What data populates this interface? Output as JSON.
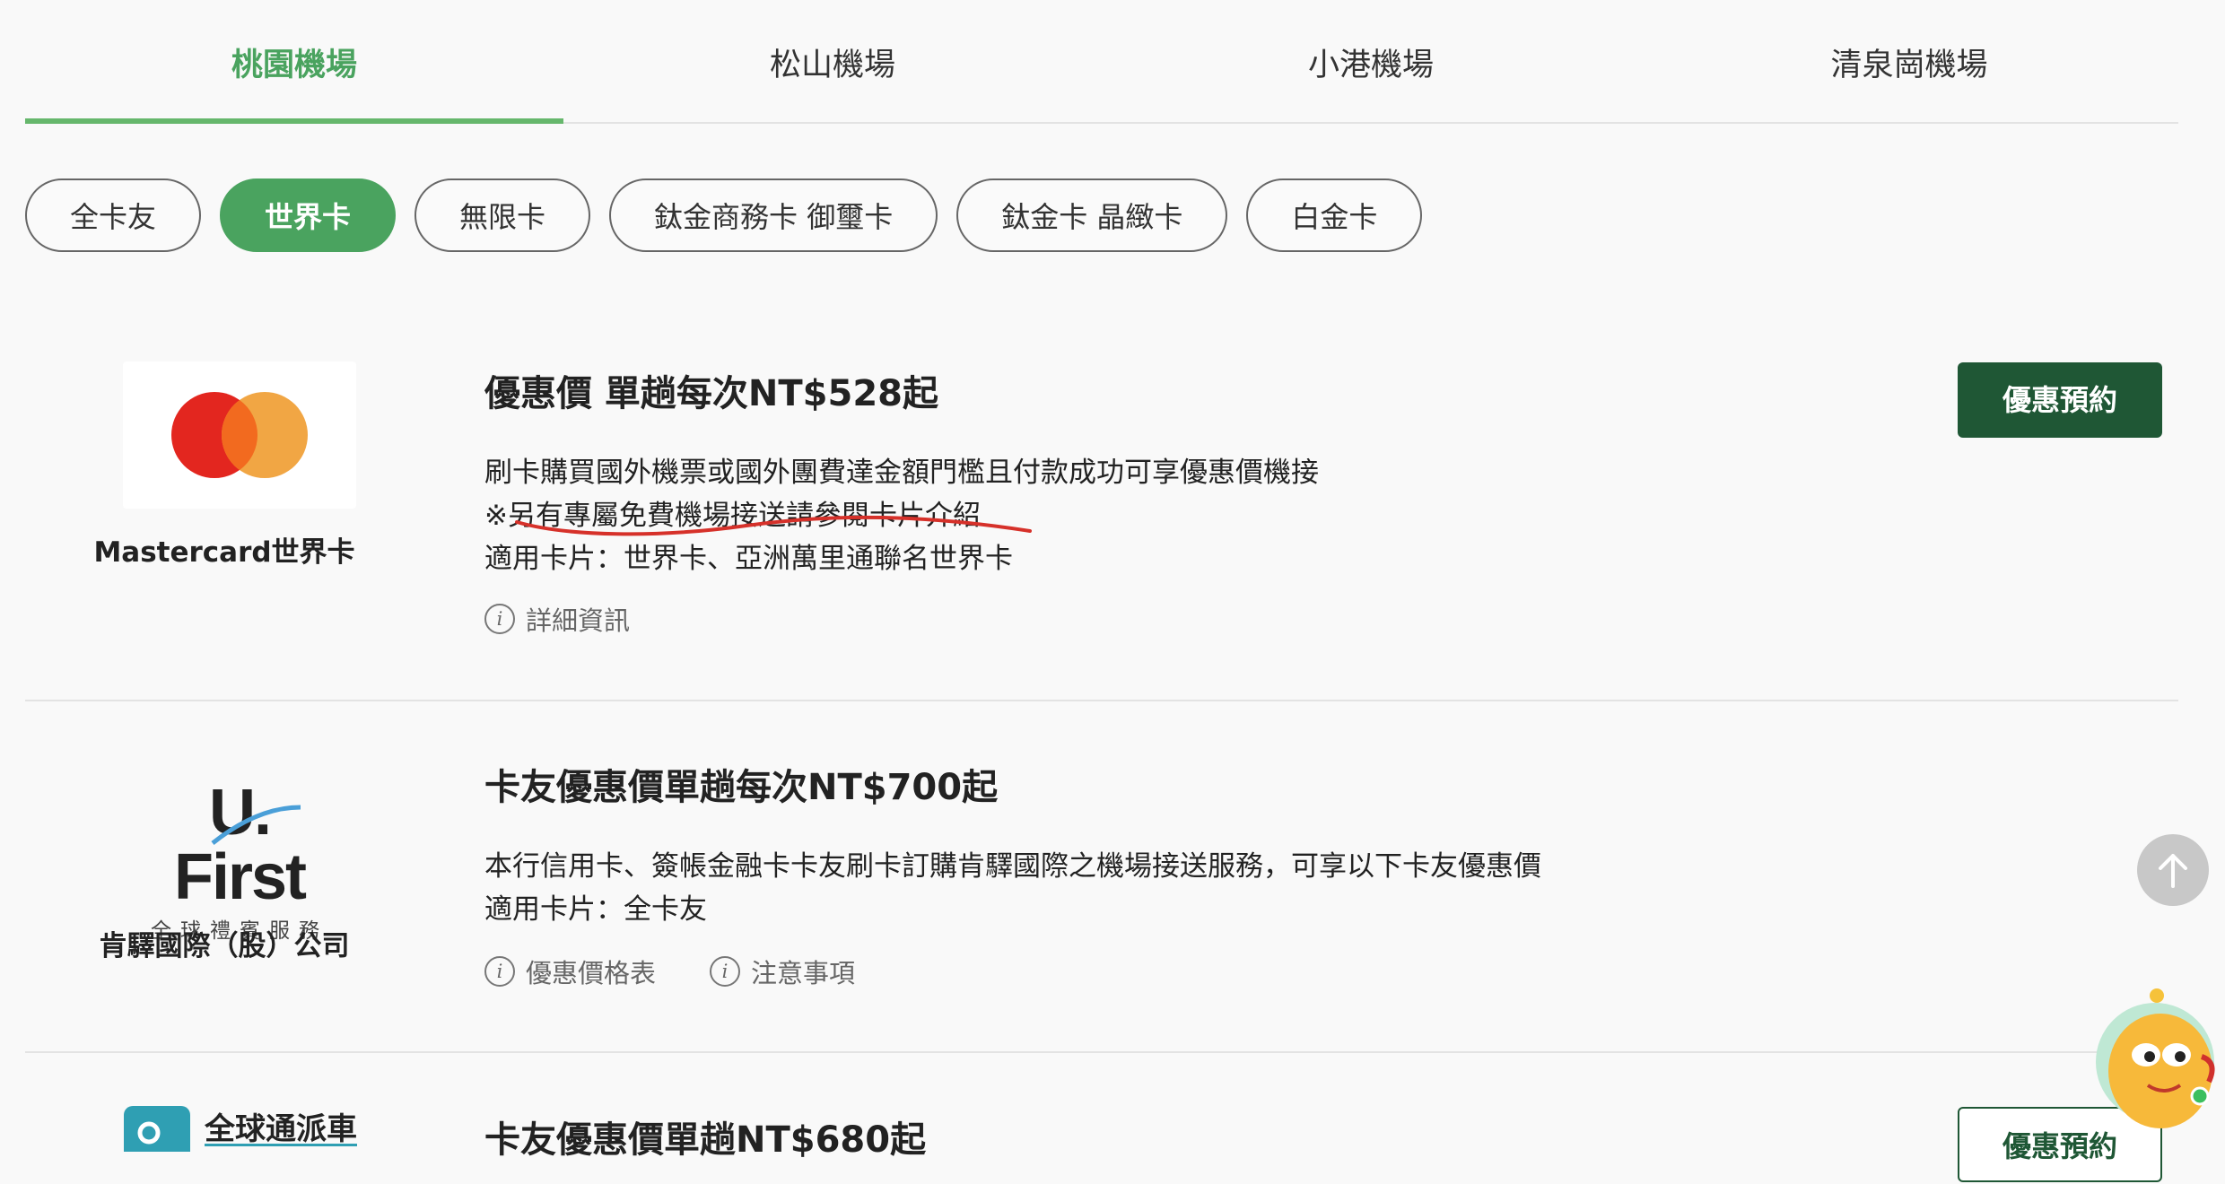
{
  "tabs": [
    {
      "label": "桃園機場"
    },
    {
      "label": "松山機場"
    },
    {
      "label": "小港機場"
    },
    {
      "label": "清泉崗機場"
    }
  ],
  "pills": [
    {
      "label": "全卡友"
    },
    {
      "label": "世界卡"
    },
    {
      "label": "無限卡"
    },
    {
      "label": "鈦金商務卡 御璽卡"
    },
    {
      "label": "鈦金卡 晶緻卡"
    },
    {
      "label": "白金卡"
    }
  ],
  "offers": [
    {
      "brand": "Mastercard世界卡",
      "logo_icon": "mastercard-logo",
      "title": "優惠價 單趟每次NT$528起",
      "lines": [
        "刷卡購買國外機票或國外團費達金額門檻且付款成功可享優惠價機接",
        "※另有專屬免費機場接送請參閱卡片介紹",
        "適用卡片：世界卡、亞洲萬里通聯名世界卡"
      ],
      "links": [
        "詳細資訊"
      ],
      "button": "優惠預約"
    },
    {
      "brand": "肯驛國際（股）公司",
      "logo_icon": "ufirst-logo",
      "logo_text": "U. First",
      "logo_sub": "全球禮賓服務",
      "title": "卡友優惠價單趟每次NT$700起",
      "lines": [
        "本行信用卡、簽帳金融卡卡友刷卡訂購肯驛國際之機場接送服務，可享以下卡友優惠價",
        "適用卡片：全卡友"
      ],
      "links": [
        "優惠價格表",
        "注意事項"
      ]
    },
    {
      "logo_icon": "global-dispatch-logo",
      "logo_text": "全球通派車",
      "title": "卡友優惠價單趟NT$680起",
      "button": "優惠預約"
    }
  ],
  "colors": {
    "accent": "#4aa35f",
    "button_dark": "#1f5735",
    "underline_red": "#d6312a"
  }
}
